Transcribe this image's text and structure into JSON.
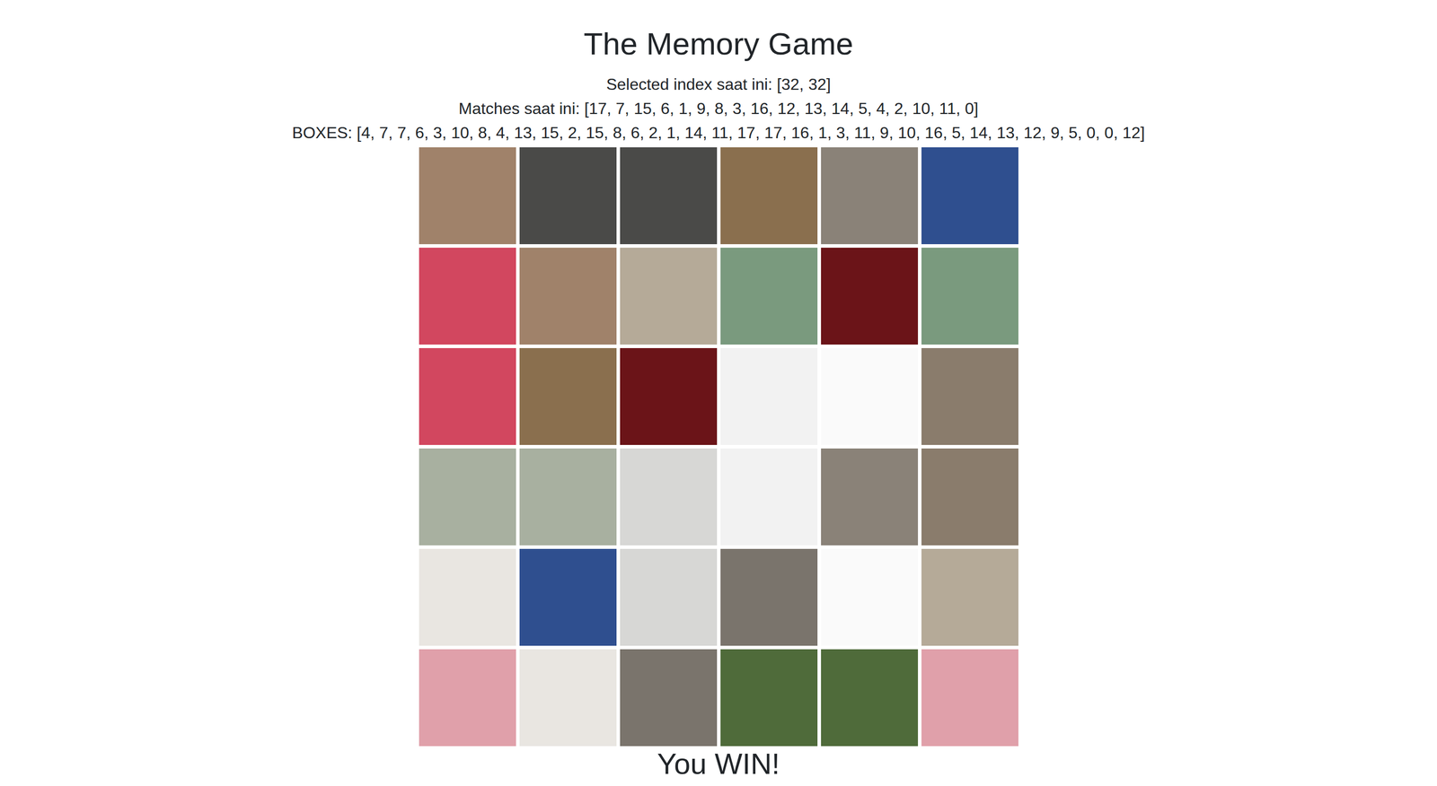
{
  "title": "The Memory Game",
  "info": {
    "selected": "Selected index saat ini: [32, 32]",
    "matches": "Matches saat ini: [17, 7, 15, 6, 1, 9, 8, 3, 16, 12, 13, 14, 5, 4, 2, 10, 11, 0]",
    "boxes": "BOXES: [4, 7, 7, 6, 3, 10, 8, 4, 13, 15, 2, 15, 8, 6, 2, 1, 14, 11, 17, 17, 16, 1, 3, 11, 9, 10, 16, 5, 14, 13, 12, 9, 5, 0, 0, 12]"
  },
  "tiles": [
    {
      "color": "#a0826a"
    },
    {
      "color": "#4a4a48"
    },
    {
      "color": "#4a4a48"
    },
    {
      "color": "#8a6f4e"
    },
    {
      "color": "#8a8278"
    },
    {
      "color": "#2f4f8f"
    },
    {
      "color": "#d2475f"
    },
    {
      "color": "#a0826a"
    },
    {
      "color": "#b5aa98"
    },
    {
      "color": "#7a9a7e"
    },
    {
      "color": "#6b1418"
    },
    {
      "color": "#7a9a7e"
    },
    {
      "color": "#d2475f"
    },
    {
      "color": "#8a6f4e"
    },
    {
      "color": "#6b1418"
    },
    {
      "color": "#f2f2f2"
    },
    {
      "color": "#fafafa"
    },
    {
      "color": "#8a7c6c"
    },
    {
      "color": "#a8b0a0"
    },
    {
      "color": "#a8b0a0"
    },
    {
      "color": "#d7d7d5"
    },
    {
      "color": "#f2f2f2"
    },
    {
      "color": "#8a8278"
    },
    {
      "color": "#8a7c6c"
    },
    {
      "color": "#e9e6e1"
    },
    {
      "color": "#2f4f8f"
    },
    {
      "color": "#d7d7d5"
    },
    {
      "color": "#7a746c"
    },
    {
      "color": "#fafafa"
    },
    {
      "color": "#b5aa98"
    },
    {
      "color": "#e0a0aa"
    },
    {
      "color": "#e9e6e1"
    },
    {
      "color": "#7a746c"
    },
    {
      "color": "#4f6b3a"
    },
    {
      "color": "#4f6b3a"
    },
    {
      "color": "#e0a0aa"
    }
  ],
  "result": "You WIN!"
}
